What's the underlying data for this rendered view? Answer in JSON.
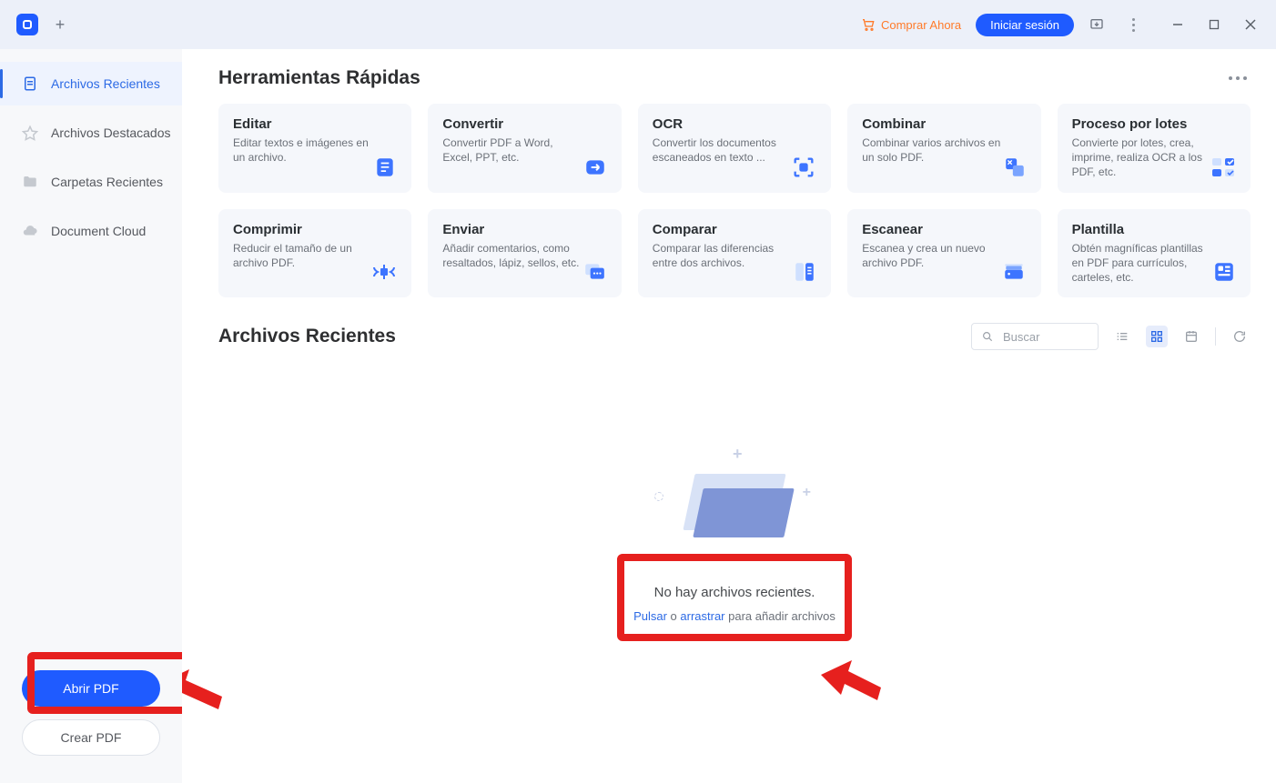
{
  "titlebar": {
    "buy_now_label": "Comprar Ahora",
    "login_label": "Iniciar sesión"
  },
  "sidebar": {
    "items": [
      {
        "label": "Archivos Recientes"
      },
      {
        "label": "Archivos Destacados"
      },
      {
        "label": "Carpetas Recientes"
      },
      {
        "label": "Document Cloud"
      }
    ],
    "open_pdf_label": "Abrir PDF",
    "create_pdf_label": "Crear PDF"
  },
  "quick_tools": {
    "heading": "Herramientas Rápidas",
    "cards": [
      {
        "title": "Editar",
        "desc": "Editar textos e imágenes en un archivo."
      },
      {
        "title": "Convertir",
        "desc": "Convertir PDF a Word, Excel, PPT, etc."
      },
      {
        "title": "OCR",
        "desc": "Convertir los documentos escaneados en texto ..."
      },
      {
        "title": "Combinar",
        "desc": "Combinar varios archivos en un solo PDF."
      },
      {
        "title": "Proceso por lotes",
        "desc": "Convierte por lotes, crea, imprime, realiza OCR a los PDF, etc."
      },
      {
        "title": "Comprimir",
        "desc": "Reducir el tamaño de un archivo PDF."
      },
      {
        "title": "Enviar",
        "desc": "Añadir comentarios, como resaltados, lápiz, sellos, etc."
      },
      {
        "title": "Comparar",
        "desc": "Comparar las diferencias entre dos archivos."
      },
      {
        "title": "Escanear",
        "desc": "Escanea y crea un nuevo archivo PDF."
      },
      {
        "title": "Plantilla",
        "desc": "Obtén magníficas plantillas en PDF para currículos, carteles, etc."
      }
    ]
  },
  "recent": {
    "heading": "Archivos Recientes",
    "search_placeholder": "Buscar",
    "empty_title": "No hay archivos recientes.",
    "empty_sub_click": "Pulsar",
    "empty_sub_or": " o ",
    "empty_sub_drag": "arrastrar",
    "empty_sub_rest": " para añadir archivos"
  }
}
